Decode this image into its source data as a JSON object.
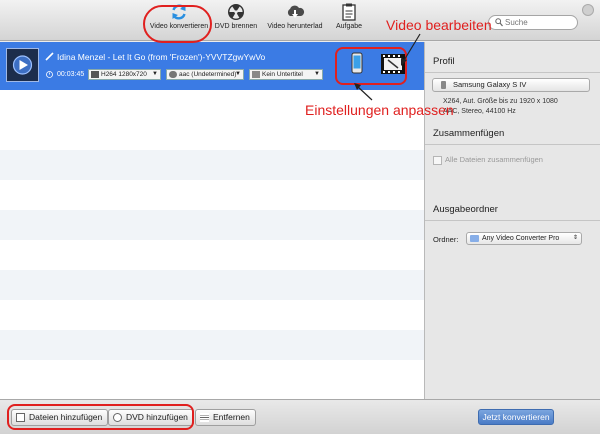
{
  "toolbar": {
    "items": [
      {
        "label": "Video konvertieren",
        "icon": "refresh-icon"
      },
      {
        "label": "DVD brennen",
        "icon": "radiation-icon"
      },
      {
        "label": "Video herunterlad",
        "icon": "cloud-download-icon"
      },
      {
        "label": "Aufgabe",
        "icon": "clipboard-icon"
      }
    ],
    "search_placeholder": "Suche"
  },
  "video": {
    "title": "Idina Menzel - Let It Go (from 'Frozen')-YVVTZgwYwVo",
    "duration": "00:03:45",
    "video_format": "H264 1280x720",
    "audio_format": "aac (Undetermined)",
    "subtitle": "Kein Untertitel"
  },
  "annotations": {
    "video_bearbeiten": "Video bearbeiten",
    "einstellungen_anpassen": "Einstellungen anpassen"
  },
  "panel": {
    "profile_title": "Profil",
    "profile_device": "Samsung Galaxy S IV",
    "profile_info_1": "X264, Aut. Größe bis zu 1920 x 1080",
    "profile_info_2": "AAC, Stereo, 44100 Hz",
    "merge_title": "Zusammenfügen",
    "merge_checkbox": "Alle Dateien zusammenfügen",
    "output_title": "Ausgabeordner",
    "output_label": "Ordner:",
    "output_folder": "Any Video Converter Pro"
  },
  "bottom": {
    "add_files": "Dateien hinzufügen",
    "add_dvd": "DVD hinzufügen",
    "remove": "Entfernen",
    "convert_now": "Jetzt konvertieren"
  },
  "colors": {
    "selection_blue": "#3b7be4",
    "annotation_red": "#e0201f",
    "convert_button": "#5b8ad2"
  }
}
